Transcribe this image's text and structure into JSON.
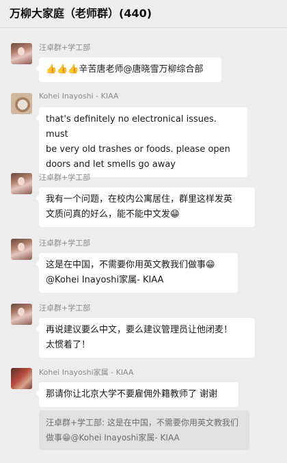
{
  "chat": {
    "title": "万柳大家庭（老师群）(440)"
  },
  "messages": [
    {
      "sender": "汪卓群+学工部",
      "avatar": "person-photo-avatar",
      "text": "👍👍👍辛苦唐老师@唐晓雪万柳综合部"
    },
    {
      "sender": "Kohei Inayoshi - KIAA",
      "avatar": "coffee-cup-avatar",
      "text": "that's definitely no electronical issues. must\nbe very old trashes or foods. please open\ndoors and let smells go away"
    },
    {
      "sender": "汪卓群+学工部",
      "avatar": "person-photo-avatar",
      "text": "我有一个问题，在校内公寓居住，群里这样发英\n文质问真的好么，能不能中文发😁"
    },
    {
      "sender": "汪卓群+学工部",
      "avatar": "person-photo-avatar",
      "text": "这是在中国，不需要你用英文教我们做事😁\n@Kohei Inayoshi家属- KIAA"
    },
    {
      "sender": "汪卓群+学工部",
      "avatar": "person-photo-avatar",
      "text": "再说建议要么中文，要么建议管理员让他闭麦！\n太惯着了！"
    },
    {
      "sender": "Kohei Inayoshi家属 - KIAA",
      "avatar": "food-photo-avatar",
      "text": "那请你让北京大学不要雇佣外籍教师了 谢谢",
      "quote": "汪卓群+学工部: 这是在中国，不需要你用英文教我们\n做事😁@Kohei Inayoshi家属- KIAA"
    }
  ]
}
